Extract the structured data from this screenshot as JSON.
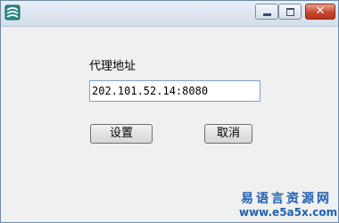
{
  "window": {
    "title": "",
    "close_label": "✕"
  },
  "form": {
    "label": "代理地址",
    "proxy_value": "202.101.52.14:8080",
    "set_label": "设置",
    "cancel_label": "取消"
  },
  "watermark": {
    "site_name": "易语言资源网",
    "url": "www.e5a5x.com"
  },
  "colors": {
    "titlebar": "#dce5f0",
    "close_button": "#c9452e",
    "watermark": "#1f5fb0"
  }
}
